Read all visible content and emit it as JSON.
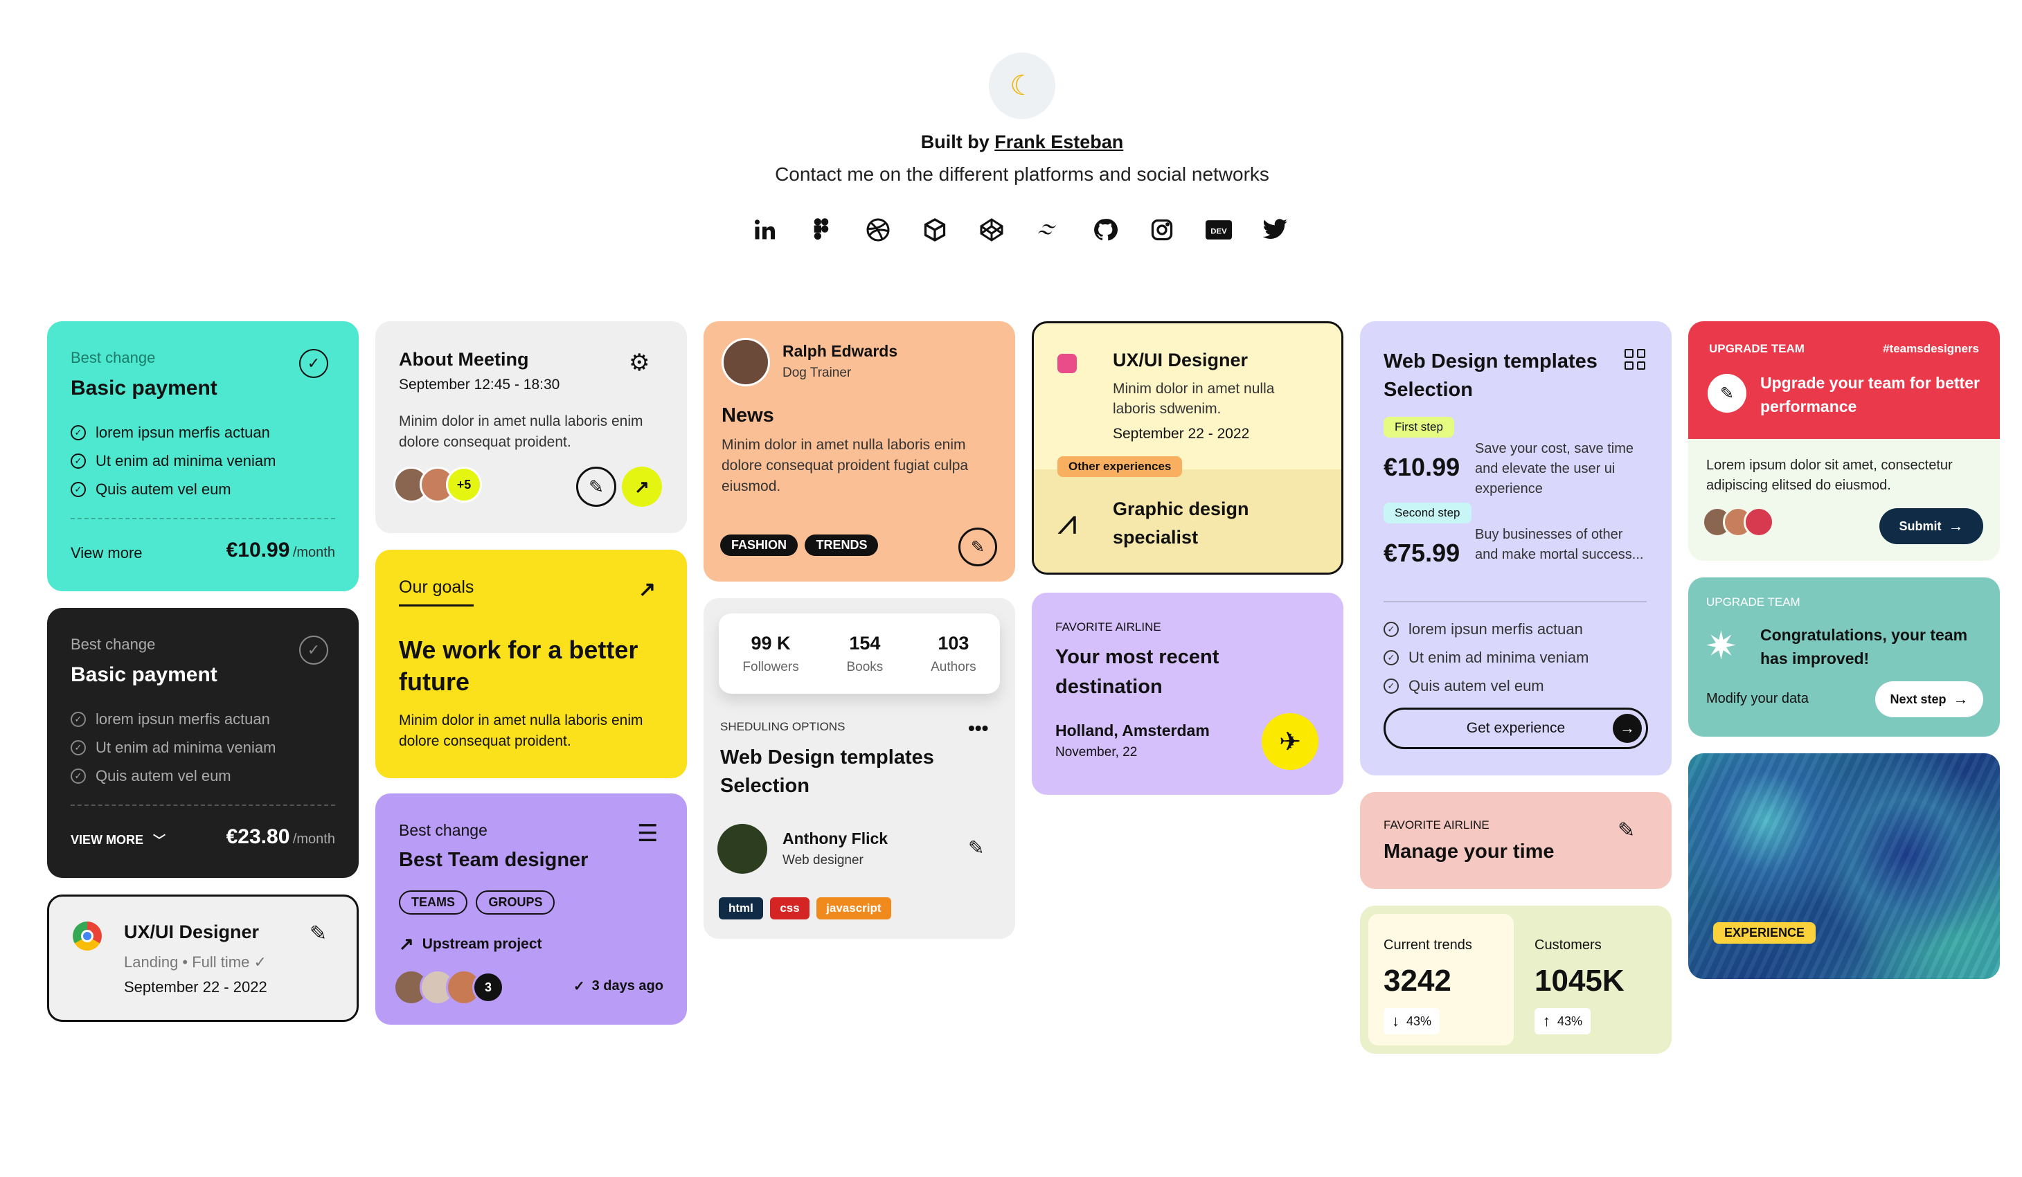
{
  "header": {
    "built_prefix": "Built by ",
    "author": "Frank Esteban",
    "contact": "Contact me on the different platforms and social networks",
    "socials": [
      "linkedin-icon",
      "figma-icon",
      "dribbble-icon",
      "box-icon",
      "codepen-icon",
      "tailwind-icon",
      "github-icon",
      "instagram-icon",
      "dev-icon",
      "twitter-icon"
    ]
  },
  "c1": {
    "kicker": "Best change",
    "title": "Basic payment",
    "items": [
      "lorem ipsun merfis actuan",
      "Ut enim ad minima veniam",
      "Quis autem vel eum"
    ],
    "view": "View more",
    "price": "€10.99",
    "per": "/month",
    "bg": "#4de8cf"
  },
  "c2": {
    "kicker": "Best change",
    "title": "Basic payment",
    "items": [
      "lorem ipsun merfis actuan",
      "Ut enim ad minima veniam",
      "Quis autem vel eum"
    ],
    "view": "VIEW MORE",
    "price": "€23.80",
    "per": "/month",
    "bg": "#1f1f1f"
  },
  "c3": {
    "title": "UX/UI Designer",
    "meta": "Landing • Full time",
    "date": "September 22 - 2022"
  },
  "c4": {
    "title": "About Meeting",
    "time": "September 12:45 - 18:30",
    "text": "Minim dolor in amet nulla laboris enim dolore consequat proident.",
    "plus": "+5"
  },
  "c5": {
    "kicker": "Our goals",
    "title": "We work for a better future",
    "text": "Minim dolor in amet nulla laboris enim dolore consequat proident.",
    "bg": "#fbe11c"
  },
  "c6": {
    "kicker": "Best change",
    "title": "Best Team designer",
    "tags": [
      "TEAMS",
      "GROUPS"
    ],
    "project": "Upstream project",
    "count": "3",
    "ago": "3 days ago",
    "bg": "#b89cf5"
  },
  "c7": {
    "name": "Ralph Edwards",
    "role": "Dog Trainer",
    "title": "News",
    "text": "Minim dolor in amet nulla laboris enim dolore consequat proident fugiat culpa eiusmod.",
    "tags": [
      "FASHION",
      "TRENDS"
    ],
    "bg": "#fbbf95"
  },
  "c8": {
    "stats": [
      {
        "v": "99 K",
        "l": "Followers"
      },
      {
        "v": "154",
        "l": "Books"
      },
      {
        "v": "103",
        "l": "Authors"
      }
    ],
    "kicker": "SHEDULING OPTIONS",
    "title": "Web Design templates Selection",
    "name": "Anthony Flick",
    "role": "Web designer",
    "tags": [
      "html",
      "css",
      "javascript"
    ]
  },
  "c9": {
    "title": "UX/UI Designer",
    "text": "Minim dolor in amet nulla laboris sdwenim.",
    "date": "September 22 - 2022",
    "badge": "Other experiences",
    "sub": "Graphic design specialist"
  },
  "c10": {
    "kicker": "FAVORITE AIRLINE",
    "title": "Your most recent destination",
    "place": "Holland, Amsterdam",
    "date": "November, 22",
    "bg": "#d5c0fb"
  },
  "c11": {
    "title": "Web Design templates Selection",
    "step1": "First step",
    "price1": "€10.99",
    "desc1": "Save your cost, save time and elevate the user ui experience",
    "step2": "Second step",
    "price2": "€75.99",
    "desc2": "Buy businesses of other and make mortal success...",
    "items": [
      "lorem ipsun merfis actuan",
      "Ut enim ad minima veniam",
      "Quis autem vel eum"
    ],
    "cta": "Get experience",
    "bg": "#d9d7fc"
  },
  "c12": {
    "kicker": "FAVORITE AIRLINE",
    "title": "Manage your time",
    "bg": "#f5c9c2"
  },
  "c13": {
    "l1": "Current trends",
    "v1": "3242",
    "p1": "43%",
    "l2": "Customers",
    "v2": "1045K",
    "p2": "43%"
  },
  "c14": {
    "kicker": "UPGRADE TEAM",
    "hash": "#teamsdesigners",
    "title": "Upgrade your team for better performance",
    "text": "Lorem ipsum dolor sit amet, consectetur adipiscing elitsed do eiusmod.",
    "cta": "Submit",
    "bg": "#e9394a"
  },
  "c15": {
    "kicker": "UPGRADE TEAM",
    "title": "Congratulations, your team has improved!",
    "link": "Modify your data",
    "cta": "Next step",
    "bg": "#7ec9bd"
  },
  "c16": {
    "badge": "EXPERIENCE"
  }
}
